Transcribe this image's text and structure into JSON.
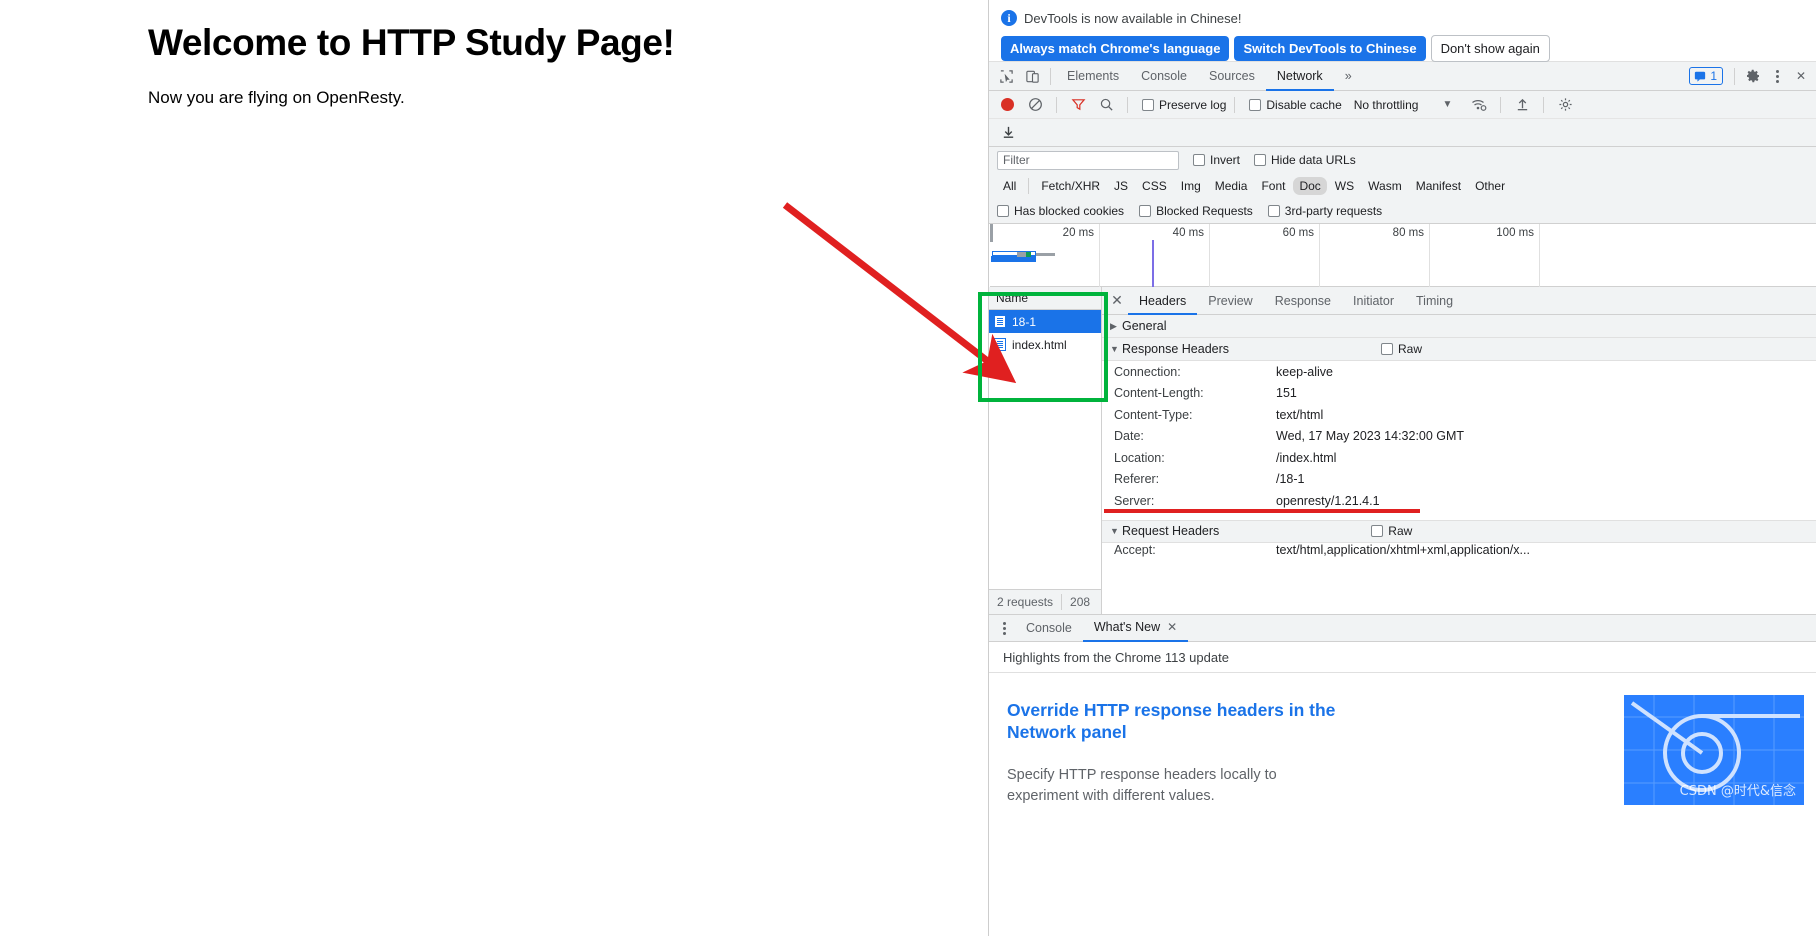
{
  "page": {
    "title": "Welcome to HTTP Study Page!",
    "paragraph": "Now you are flying on OpenResty."
  },
  "devtools": {
    "banner": {
      "icon": "info-icon",
      "message": "DevTools is now available in Chinese!",
      "primary_buttons": [
        "Always match Chrome's language",
        "Switch DevTools to Chinese"
      ],
      "secondary_button": "Don't show again"
    },
    "tabbar": {
      "inspect_icon": "inspect-element-icon",
      "device_icon": "device-toolbar-icon",
      "tabs": [
        {
          "label": "Elements",
          "active": false
        },
        {
          "label": "Console",
          "active": false
        },
        {
          "label": "Sources",
          "active": false
        },
        {
          "label": "Network",
          "active": true
        }
      ],
      "more_tabs": "»",
      "message_count": "1",
      "message_icon": "message-badge-icon",
      "settings_icon": "gear-icon",
      "menu_icon": "kebab-menu-icon",
      "close_icon": "close-devtools-icon"
    },
    "network_controls": {
      "record_icon": "record-button-icon",
      "clear_icon": "clear-network-icon",
      "filter_icon": "filter-funnel-icon",
      "search_icon": "search-icon",
      "preserve_log": "Preserve log",
      "disable_cache": "Disable cache",
      "throttling": "No throttling",
      "throttling_caret": "▼",
      "network_conditions_icon": "network-conditions-icon",
      "import_icon": "import-har-icon",
      "export_icon": "export-har-icon",
      "download_icon": "download-har-icon"
    },
    "filter_bar": {
      "placeholder": "Filter",
      "value": "",
      "invert": "Invert",
      "hide_data_urls": "Hide data URLs",
      "types": [
        "All",
        "Fetch/XHR",
        "JS",
        "CSS",
        "Img",
        "Media",
        "Font",
        "Doc",
        "WS",
        "Wasm",
        "Manifest",
        "Other"
      ],
      "selected_type": "Doc",
      "has_blocked_cookies": "Has blocked cookies",
      "blocked_requests": "Blocked Requests",
      "third_party_requests": "3rd-party requests"
    },
    "overview": {
      "ticks": [
        "20 ms",
        "40 ms",
        "60 ms",
        "80 ms",
        "100 ms"
      ]
    },
    "request_list": {
      "column_header": "Name",
      "rows": [
        {
          "name": "18-1",
          "icon": "document-icon",
          "selected": true
        },
        {
          "name": "index.html",
          "icon": "document-icon",
          "selected": false
        }
      ],
      "footer": {
        "requests": "2 requests",
        "transferred": "208"
      }
    },
    "detail": {
      "close_icon": "close-icon",
      "tabs": [
        {
          "label": "Headers",
          "active": true
        },
        {
          "label": "Preview",
          "active": false
        },
        {
          "label": "Response",
          "active": false
        },
        {
          "label": "Initiator",
          "active": false
        },
        {
          "label": "Timing",
          "active": false
        }
      ],
      "general": {
        "label": "General",
        "expanded": false,
        "triangle": "▶"
      },
      "response_headers": {
        "label": "Response Headers",
        "expanded": true,
        "triangle": "▼",
        "raw_label": "Raw",
        "items": [
          {
            "key": "Connection:",
            "value": "keep-alive"
          },
          {
            "key": "Content-Length:",
            "value": "151"
          },
          {
            "key": "Content-Type:",
            "value": "text/html"
          },
          {
            "key": "Date:",
            "value": "Wed, 17 May 2023 14:32:00 GMT"
          },
          {
            "key": "Location:",
            "value": "/index.html"
          },
          {
            "key": "Referer:",
            "value": "/18-1"
          },
          {
            "key": "Server:",
            "value": "openresty/1.21.4.1"
          }
        ]
      },
      "request_headers": {
        "label": "Request Headers",
        "expanded": true,
        "triangle": "▼",
        "raw_label": "Raw",
        "items": [
          {
            "key": "Accept:",
            "value": "text/html,application/xhtml+xml,application/x..."
          }
        ]
      }
    },
    "drawer": {
      "menu_icon": "kebab-menu-icon",
      "tabs": [
        {
          "label": "Console",
          "active": false
        },
        {
          "label": "What's New",
          "active": true,
          "close": "✕"
        }
      ],
      "subtitle": "Highlights from the Chrome 113 update",
      "whats_new": {
        "title": "Override HTTP response headers in the Network panel",
        "description": "Specify HTTP response headers locally to experiment with different values.",
        "thumbnail_icon": "chrome-devtools-thumbnail",
        "watermark": "CSDN @时代&信念"
      }
    }
  },
  "annotations": {
    "arrow": {
      "color": "#e02020",
      "name": "red-arrow-annotation"
    },
    "highlight_box": {
      "color": "#00b33c",
      "name": "green-highlight-box-annotation"
    },
    "underline": {
      "color": "#e02020",
      "name": "red-underline-annotation"
    }
  },
  "colors": {
    "accent": "#1a73e8",
    "record": "#d93025",
    "annotation_red": "#e02020",
    "annotation_green": "#00b33c",
    "panel_bg": "#f1f3f4"
  }
}
